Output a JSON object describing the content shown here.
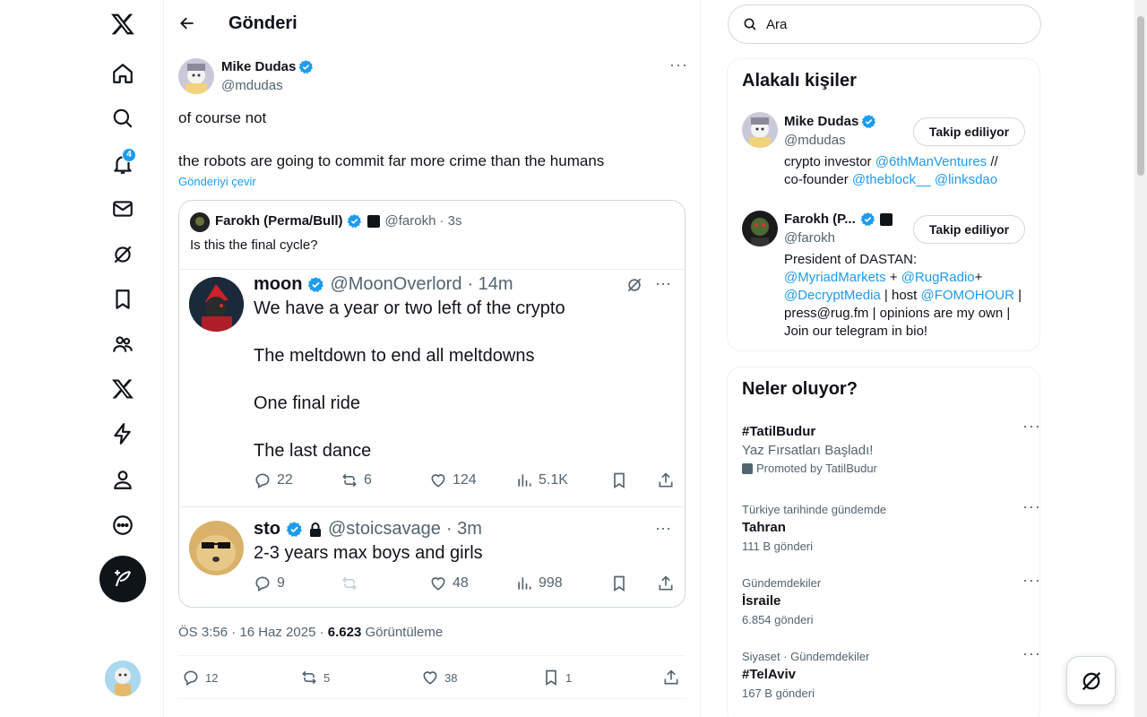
{
  "nav": {
    "notifications_badge": "4"
  },
  "header": {
    "title": "Gönderi"
  },
  "post": {
    "author_name": "Mike Dudas",
    "author_handle": "@mdudas",
    "text_line1": "of course not",
    "text_line2": "the robots are going to commit far more crime than the humans",
    "translate": "Gönderiyi çevir",
    "timestamp": "ÖS 3:56 · 16 Haz 2025 · ",
    "views_count": "6.623",
    "views_label": " Görüntüleme",
    "replies": "12",
    "reposts": "5",
    "likes": "38",
    "bookmarks": "1"
  },
  "quote": {
    "author_name": "Farokh (Perma/Bull)",
    "author_handle": "@farokh",
    "time": "· 3s",
    "text": "Is this the final cycle?",
    "shot1": {
      "name": "moon",
      "handle": "@MoonOverlord",
      "time": "· 14m",
      "line1": "We have a year or two left of the crypto",
      "line2": "The meltdown to end all meltdowns",
      "line3": "One final ride",
      "line4": "The last dance",
      "replies": "22",
      "reposts": "6",
      "likes": "124",
      "views": "5.1K"
    },
    "shot2": {
      "name": "sto",
      "handle": "@stoicsavage",
      "time": "· 3m",
      "text": "2-3 years max boys and girls",
      "replies": "9",
      "likes": "48",
      "views": "998"
    }
  },
  "search": {
    "placeholder": "Ara"
  },
  "related": {
    "title": "Alakalı kişiler",
    "people": [
      {
        "name": "Mike Dudas",
        "handle": "@mdudas",
        "button": "Takip ediliyor",
        "bio_prefix": "crypto investor ",
        "bio_link1": "@6thManVentures",
        "bio_mid": " //",
        "bio_line2_prefix": "co-founder ",
        "bio_link2": "@theblock__",
        "bio_link3": "@linksdao"
      },
      {
        "name": "Farokh (P...",
        "handle": "@farokh",
        "button": "Takip ediliyor",
        "bio_l1": "President of DASTAN:",
        "bio_link1": "@MyriadMarkets",
        "bio_plus1": " + ",
        "bio_link2": "@RugRadio",
        "bio_plus2": "+",
        "bio_link3": "@DecryptMedia",
        "bio_host": " | host ",
        "bio_link4": "@FOMOHOUR",
        "bio_pipe": " |",
        "bio_l4": "press@rug.fm | opinions are my own |",
        "bio_l5": "Join our telegram in bio!"
      }
    ]
  },
  "trends": {
    "title": "Neler oluyor?",
    "items": [
      {
        "name": "#TatilBudur",
        "sub": "Yaz Fırsatları Başladı!",
        "promoted": "Promoted by TatilBudur"
      },
      {
        "context": "Türkiye tarihinde gündemde",
        "name": "Tahran",
        "count": "111 B gönderi"
      },
      {
        "context": "Gündemdekiler",
        "name": "İsraile",
        "count": "6.854 gönderi"
      },
      {
        "context": "Siyaset · Gündemdekiler",
        "name": "#TelAviv",
        "count": "167 B gönderi"
      }
    ]
  },
  "colors": {
    "accent": "#1d9bf0",
    "text": "#0f1419",
    "muted": "#536471",
    "border": "#cfd9de"
  }
}
